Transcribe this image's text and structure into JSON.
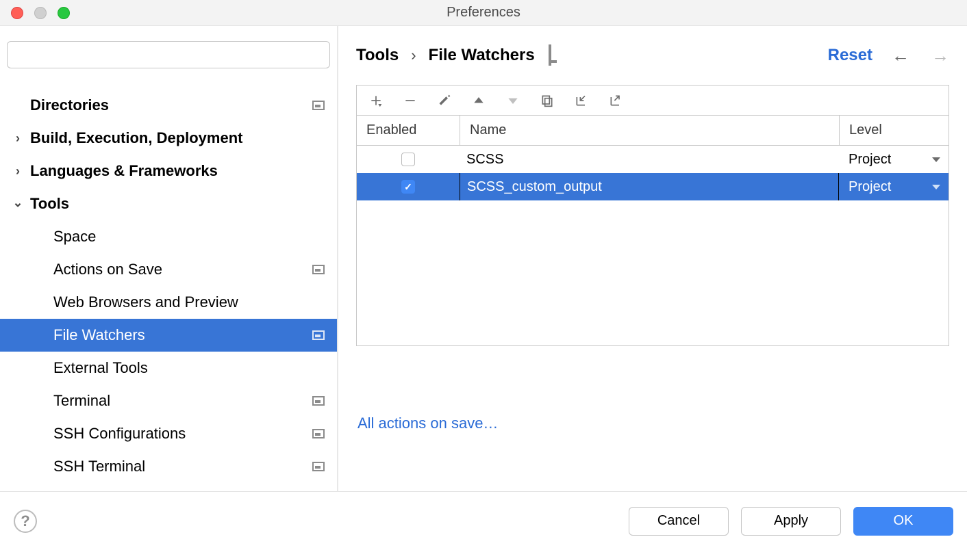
{
  "window": {
    "title": "Preferences"
  },
  "search": {
    "placeholder": ""
  },
  "sidebar": {
    "items": [
      {
        "label": "Directories",
        "top": true,
        "arrow": "",
        "bc": true
      },
      {
        "label": "Build, Execution, Deployment",
        "top": true,
        "arrow": ">",
        "bc": false
      },
      {
        "label": "Languages & Frameworks",
        "top": true,
        "arrow": ">",
        "bc": false
      },
      {
        "label": "Tools",
        "top": true,
        "arrow": "v",
        "bc": false
      },
      {
        "label": "Space",
        "top": false,
        "bc": false
      },
      {
        "label": "Actions on Save",
        "top": false,
        "bc": true
      },
      {
        "label": "Web Browsers and Preview",
        "top": false,
        "bc": false
      },
      {
        "label": "File Watchers",
        "top": false,
        "bc": true,
        "selected": true
      },
      {
        "label": "External Tools",
        "top": false,
        "bc": false
      },
      {
        "label": "Terminal",
        "top": false,
        "bc": true
      },
      {
        "label": "SSH Configurations",
        "top": false,
        "bc": true
      },
      {
        "label": "SSH Terminal",
        "top": false,
        "bc": true
      }
    ]
  },
  "breadcrumb": {
    "parent": "Tools",
    "current": "File Watchers"
  },
  "header": {
    "reset": "Reset"
  },
  "table": {
    "columns": {
      "enabled": "Enabled",
      "name": "Name",
      "level": "Level"
    },
    "rows": [
      {
        "enabled": false,
        "name": "SCSS",
        "level": "Project",
        "selected": false
      },
      {
        "enabled": true,
        "name": "SCSS_custom_output",
        "level": "Project",
        "selected": true
      }
    ]
  },
  "links": {
    "all_actions": "All actions on save…"
  },
  "footer": {
    "cancel": "Cancel",
    "apply": "Apply",
    "ok": "OK"
  }
}
